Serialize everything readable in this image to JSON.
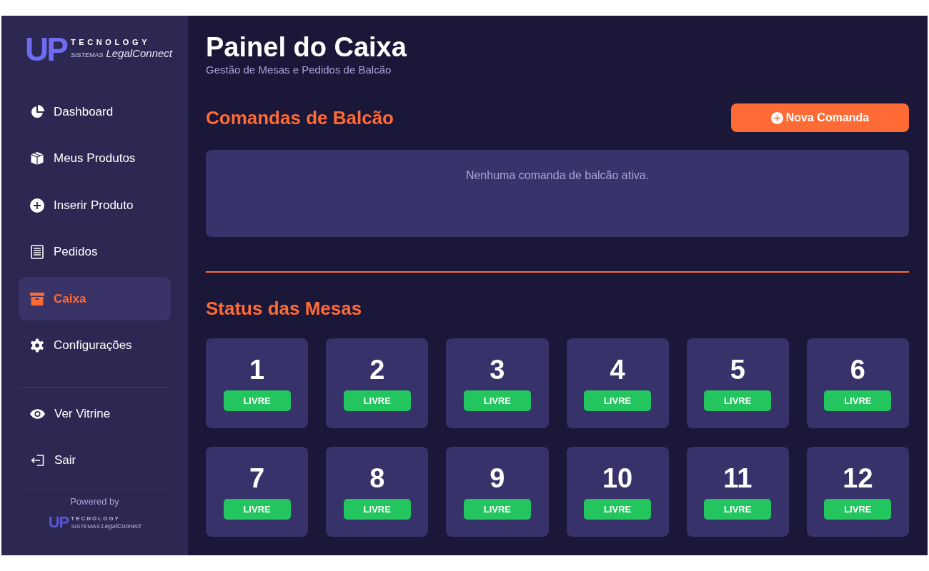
{
  "sidebar": {
    "logo": {
      "mark": "UP",
      "name": "TECNOLOGY",
      "tagline_prefix": "SISTEMAS",
      "tagline": "LegalConnect"
    },
    "nav_items": [
      {
        "label": "Dashboard",
        "selected": false
      },
      {
        "label": "Meus Produtos",
        "selected": false
      },
      {
        "label": "Inserir Produto",
        "selected": false
      },
      {
        "label": "Pedidos",
        "selected": false
      },
      {
        "label": "Caixa",
        "selected": true
      },
      {
        "label": "Configurações",
        "selected": false
      }
    ],
    "footer_items": [
      "Ver Vitrine",
      "Sair"
    ],
    "powered_by": {
      "text": "Powered by",
      "logo": {
        "mark": "UP",
        "name": "TECNOLOGY",
        "tagline_prefix": "SISTEMAS",
        "tagline": "LegalConnect"
      }
    }
  },
  "header": {
    "title": "Painel do Caixa",
    "subtitle": "Gestão de Mesas e Pedidos de Balcão"
  },
  "counter_orders": {
    "title": "Comandas de Balcão",
    "new_button": "Nova Comanda",
    "empty_message": "Nenhuma comanda de balcão ativa."
  },
  "tables": {
    "title": "Status das Mesas",
    "items": [
      {
        "number": "1",
        "status": "LIVRE",
        "color": "#22c55e"
      },
      {
        "number": "2",
        "status": "LIVRE",
        "color": "#22c55e"
      },
      {
        "number": "3",
        "status": "LIVRE",
        "color": "#22c55e"
      },
      {
        "number": "4",
        "status": "LIVRE",
        "color": "#22c55e"
      },
      {
        "number": "5",
        "status": "LIVRE",
        "color": "#22c55e"
      },
      {
        "number": "6",
        "status": "LIVRE",
        "color": "#22c55e"
      },
      {
        "number": "7",
        "status": "LIVRE",
        "color": "#22c55e"
      },
      {
        "number": "8",
        "status": "LIVRE",
        "color": "#22c55e"
      },
      {
        "number": "9",
        "status": "LIVRE",
        "color": "#22c55e"
      },
      {
        "number": "10",
        "status": "LIVRE",
        "color": "#22c55e"
      },
      {
        "number": "11",
        "status": "LIVRE",
        "color": "#22c55e"
      },
      {
        "number": "12",
        "status": "LIVRE",
        "color": "#22c55e"
      }
    ]
  }
}
